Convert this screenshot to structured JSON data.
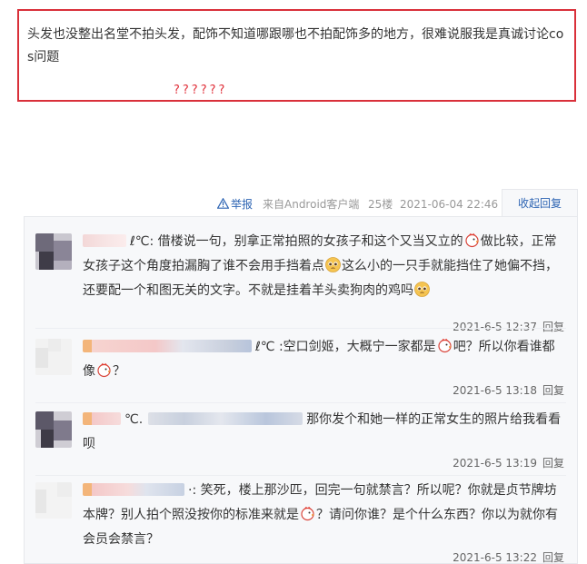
{
  "post": {
    "text": "头发也没整出名堂不拍头发，配饰不知道哪跟哪也不拍配饰多的地方，很难说服我是真诚讨论cos问题",
    "marks": "??????"
  },
  "floor_bar": {
    "report_label": "举报",
    "source": "来自Android客户端",
    "floor": "25楼",
    "time": "2021-06-04 22:46",
    "collapse_label": "收起回复"
  },
  "replies": [
    {
      "name_suffix": "ℓ℃",
      "text_parts": [
        ": 借楼说一句，别拿正常拍照的女孩子和这个又当又立的",
        "做比较，正常女孩子这个角度拍漏胸了谁不会用手挡着点",
        "这么小的一只手就能挡住了她偏不挡，还要配一个和图无关的文字。不就是挂着羊头卖狗肉的鸡吗"
      ],
      "emojis": [
        "rooster-emoji",
        "pleading-face-emoji",
        "pleading-face-emoji"
      ],
      "time": "2021-6-5 12:37",
      "reply_label": "回复"
    },
    {
      "name_suffix": "ℓ℃",
      "text_parts": [
        " :空口剑姬，大概宁一家都是",
        "吧？所以你看谁都像",
        "？"
      ],
      "emojis": [
        "rooster-emoji",
        "rooster-emoji"
      ],
      "time": "2021-6-5 13:18",
      "reply_label": "回复"
    },
    {
      "name_suffix": "℃.",
      "text_parts": [
        "那你发个和她一样的正常女生的照片给我看看呗"
      ],
      "emojis": [],
      "time": "2021-6-5 13:19",
      "reply_label": "回复"
    },
    {
      "name_suffix": "·",
      "text_parts": [
        ": 笑死，楼上那沙匹，回完一句就禁言？所以呢？你就是贞节牌坊本牌？别人拍个照没按你的标准来就是",
        "？请问你谁？是个什么东西？你以为就你有会员会禁言？"
      ],
      "emojis": [
        "rooster-emoji"
      ],
      "time": "2021-6-5 13:22",
      "reply_label": "回复"
    }
  ],
  "colors": {
    "highlight_border": "#d9303a",
    "link": "#2d64b3",
    "panel_bg": "#f7f8fa"
  }
}
